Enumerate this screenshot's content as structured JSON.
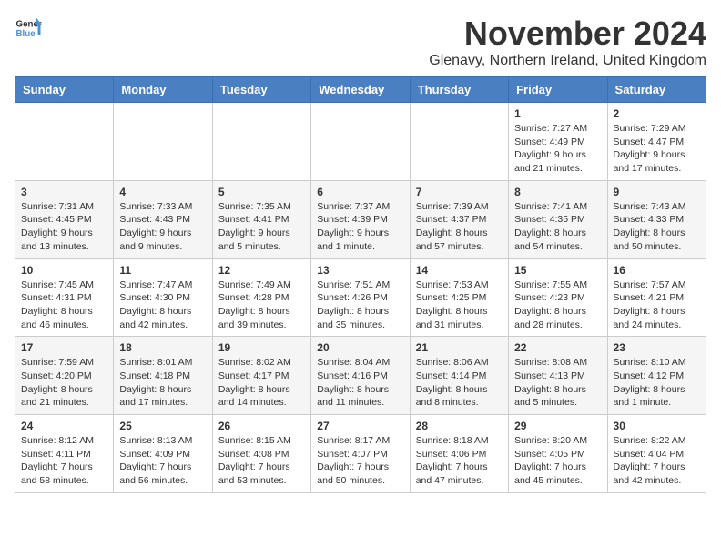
{
  "logo": {
    "general": "General",
    "blue": "Blue"
  },
  "header": {
    "month": "November 2024",
    "location": "Glenavy, Northern Ireland, United Kingdom"
  },
  "weekdays": [
    "Sunday",
    "Monday",
    "Tuesday",
    "Wednesday",
    "Thursday",
    "Friday",
    "Saturday"
  ],
  "weeks": [
    [
      {
        "day": "",
        "info": ""
      },
      {
        "day": "",
        "info": ""
      },
      {
        "day": "",
        "info": ""
      },
      {
        "day": "",
        "info": ""
      },
      {
        "day": "",
        "info": ""
      },
      {
        "day": "1",
        "info": "Sunrise: 7:27 AM\nSunset: 4:49 PM\nDaylight: 9 hours and 21 minutes."
      },
      {
        "day": "2",
        "info": "Sunrise: 7:29 AM\nSunset: 4:47 PM\nDaylight: 9 hours and 17 minutes."
      }
    ],
    [
      {
        "day": "3",
        "info": "Sunrise: 7:31 AM\nSunset: 4:45 PM\nDaylight: 9 hours and 13 minutes."
      },
      {
        "day": "4",
        "info": "Sunrise: 7:33 AM\nSunset: 4:43 PM\nDaylight: 9 hours and 9 minutes."
      },
      {
        "day": "5",
        "info": "Sunrise: 7:35 AM\nSunset: 4:41 PM\nDaylight: 9 hours and 5 minutes."
      },
      {
        "day": "6",
        "info": "Sunrise: 7:37 AM\nSunset: 4:39 PM\nDaylight: 9 hours and 1 minute."
      },
      {
        "day": "7",
        "info": "Sunrise: 7:39 AM\nSunset: 4:37 PM\nDaylight: 8 hours and 57 minutes."
      },
      {
        "day": "8",
        "info": "Sunrise: 7:41 AM\nSunset: 4:35 PM\nDaylight: 8 hours and 54 minutes."
      },
      {
        "day": "9",
        "info": "Sunrise: 7:43 AM\nSunset: 4:33 PM\nDaylight: 8 hours and 50 minutes."
      }
    ],
    [
      {
        "day": "10",
        "info": "Sunrise: 7:45 AM\nSunset: 4:31 PM\nDaylight: 8 hours and 46 minutes."
      },
      {
        "day": "11",
        "info": "Sunrise: 7:47 AM\nSunset: 4:30 PM\nDaylight: 8 hours and 42 minutes."
      },
      {
        "day": "12",
        "info": "Sunrise: 7:49 AM\nSunset: 4:28 PM\nDaylight: 8 hours and 39 minutes."
      },
      {
        "day": "13",
        "info": "Sunrise: 7:51 AM\nSunset: 4:26 PM\nDaylight: 8 hours and 35 minutes."
      },
      {
        "day": "14",
        "info": "Sunrise: 7:53 AM\nSunset: 4:25 PM\nDaylight: 8 hours and 31 minutes."
      },
      {
        "day": "15",
        "info": "Sunrise: 7:55 AM\nSunset: 4:23 PM\nDaylight: 8 hours and 28 minutes."
      },
      {
        "day": "16",
        "info": "Sunrise: 7:57 AM\nSunset: 4:21 PM\nDaylight: 8 hours and 24 minutes."
      }
    ],
    [
      {
        "day": "17",
        "info": "Sunrise: 7:59 AM\nSunset: 4:20 PM\nDaylight: 8 hours and 21 minutes."
      },
      {
        "day": "18",
        "info": "Sunrise: 8:01 AM\nSunset: 4:18 PM\nDaylight: 8 hours and 17 minutes."
      },
      {
        "day": "19",
        "info": "Sunrise: 8:02 AM\nSunset: 4:17 PM\nDaylight: 8 hours and 14 minutes."
      },
      {
        "day": "20",
        "info": "Sunrise: 8:04 AM\nSunset: 4:16 PM\nDaylight: 8 hours and 11 minutes."
      },
      {
        "day": "21",
        "info": "Sunrise: 8:06 AM\nSunset: 4:14 PM\nDaylight: 8 hours and 8 minutes."
      },
      {
        "day": "22",
        "info": "Sunrise: 8:08 AM\nSunset: 4:13 PM\nDaylight: 8 hours and 5 minutes."
      },
      {
        "day": "23",
        "info": "Sunrise: 8:10 AM\nSunset: 4:12 PM\nDaylight: 8 hours and 1 minute."
      }
    ],
    [
      {
        "day": "24",
        "info": "Sunrise: 8:12 AM\nSunset: 4:11 PM\nDaylight: 7 hours and 58 minutes."
      },
      {
        "day": "25",
        "info": "Sunrise: 8:13 AM\nSunset: 4:09 PM\nDaylight: 7 hours and 56 minutes."
      },
      {
        "day": "26",
        "info": "Sunrise: 8:15 AM\nSunset: 4:08 PM\nDaylight: 7 hours and 53 minutes."
      },
      {
        "day": "27",
        "info": "Sunrise: 8:17 AM\nSunset: 4:07 PM\nDaylight: 7 hours and 50 minutes."
      },
      {
        "day": "28",
        "info": "Sunrise: 8:18 AM\nSunset: 4:06 PM\nDaylight: 7 hours and 47 minutes."
      },
      {
        "day": "29",
        "info": "Sunrise: 8:20 AM\nSunset: 4:05 PM\nDaylight: 7 hours and 45 minutes."
      },
      {
        "day": "30",
        "info": "Sunrise: 8:22 AM\nSunset: 4:04 PM\nDaylight: 7 hours and 42 minutes."
      }
    ]
  ]
}
